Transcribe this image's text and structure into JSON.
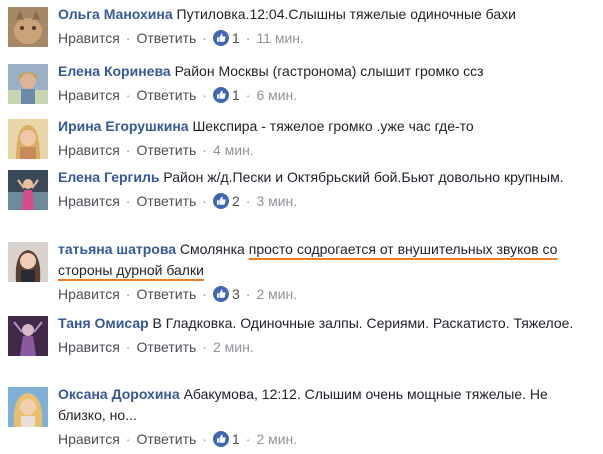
{
  "action_like": "Нравится",
  "action_reply": "Ответить",
  "separator": "·",
  "colors": {
    "name": "#365899",
    "text": "#1d2129",
    "meta": "#90949c",
    "highlight": "#ee7b20",
    "like": "#4267b2"
  },
  "comments": [
    {
      "author": "Ольга Манохина",
      "text": "Путиловка.12:04.Слышны тяжелые одиночные бахи",
      "likes": "1",
      "time": "11 мин."
    },
    {
      "author": "Елена Коринева",
      "text": "Район Москвы (гастронома) слышит громко ссз",
      "likes": "1",
      "time": "6 мин."
    },
    {
      "author": "Ирина Егорушкина",
      "text": "Шекспира - тяжелое громко .уже час где-то",
      "likes": "",
      "time": "4 мин."
    },
    {
      "author": "Елена Гергиль",
      "text": "Район ж/д.Пески и Октябрьский бой.Бьют довольно крупным.",
      "likes": "2",
      "time": "3 мин."
    },
    {
      "author": "татьяна шатрова",
      "text_plain": "Смолянка",
      "text_highlight": "просто содрогается от внушительных звуков со стороны дурной балки",
      "likes": "3",
      "time": "2 мин."
    },
    {
      "author": "Таня Омисар",
      "text": "В Гладковка. Одиночные залпы. Сериями. Раскатисто. Тяжелое.",
      "likes": "",
      "time": "2 мин."
    },
    {
      "author": "Оксана Дорохина",
      "text": "Абакумова, 12:12. Слышим очень мощные тяжелые. Не близко, но...",
      "likes": "1",
      "time": "2 мин."
    }
  ]
}
